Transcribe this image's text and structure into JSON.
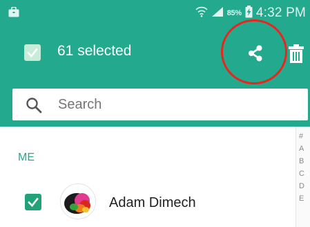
{
  "status_bar": {
    "battery_percent": "85%",
    "time": "4:32 PM",
    "icons": [
      "briefcase-icon",
      "wifi-icon",
      "signal-icon",
      "battery-charging-icon"
    ]
  },
  "action_bar": {
    "selected_label": "61 selected",
    "select_all_checked": true,
    "actions": [
      "share-icon",
      "trash-icon"
    ]
  },
  "search": {
    "placeholder": "Search",
    "value": ""
  },
  "contacts": {
    "section_header": "ME",
    "items": [
      {
        "name": "Adam Dimech",
        "checked": true
      }
    ]
  },
  "index_bar": [
    "#",
    "A",
    "B",
    "C",
    "D",
    "E"
  ],
  "colors": {
    "header": "#23a98e",
    "accent": "#23a98e",
    "checkbox": "#22a27a",
    "highlight_circle": "#e8261c"
  }
}
